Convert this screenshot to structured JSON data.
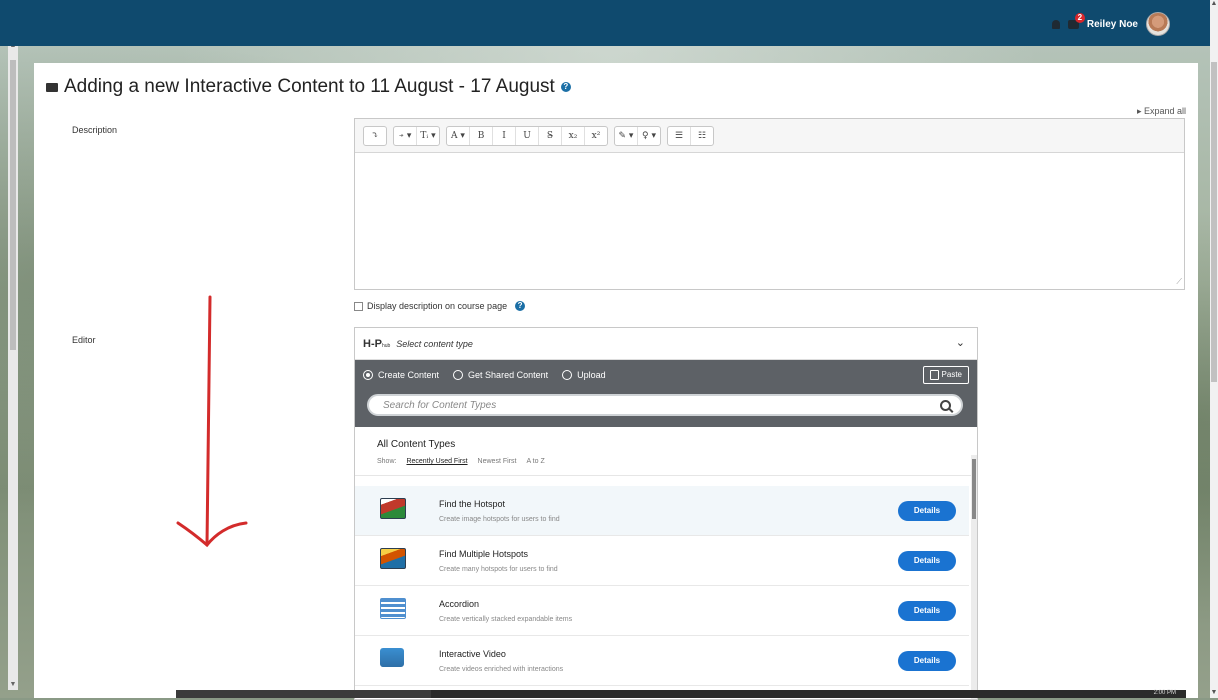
{
  "user": {
    "name": "Reiley Noe",
    "notification_count": "2"
  },
  "page": {
    "title": "Adding a new Interactive Content to 11 August - 17 August",
    "expand_all": "Expand all"
  },
  "form": {
    "description_label": "Description",
    "editor_label": "Editor",
    "display_description_label": "Display description on course page"
  },
  "toolbar": {
    "groups": [
      [
        "⤵"
      ],
      [
        "⍆ ▾",
        "Tᵢ ▾"
      ],
      [
        "A ▾",
        "B",
        "I",
        "U",
        "S̶",
        "x₂",
        "x²"
      ],
      [
        "✎ ▾",
        "♀ ▾"
      ],
      [
        "☰",
        "☷"
      ]
    ]
  },
  "h5p": {
    "logo": "H-P",
    "logo_suffix": "hub",
    "select_placeholder": "Select content type",
    "tabs": [
      "Create Content",
      "Get Shared Content",
      "Upload"
    ],
    "paste_label": "Paste",
    "search_placeholder": "Search for Content Types",
    "all_content_types": "All Content Types",
    "show_label": "Show:",
    "sort_options": [
      "Recently Used First",
      "Newest First",
      "A to Z"
    ],
    "items": [
      {
        "title": "Find the Hotspot",
        "desc": "Create image hotspots for users to find",
        "button": "Details",
        "icon": "hotspot-icon"
      },
      {
        "title": "Find Multiple Hotspots",
        "desc": "Create many hotspots for users to find",
        "button": "Details",
        "icon": "multi-hotspot-icon"
      },
      {
        "title": "Accordion",
        "desc": "Create vertically stacked expandable items",
        "button": "Details",
        "icon": "accordion-icon"
      },
      {
        "title": "Interactive Video",
        "desc": "Create videos enriched with interactions",
        "button": "Details",
        "icon": "video-icon"
      }
    ]
  },
  "taskbar": {
    "clock": "2:00 PM"
  },
  "colors": {
    "navbar": "#0f4a6e",
    "details_button": "#1a73d1",
    "h5p_bar": "#5d6166",
    "annotation": "#d32b2b"
  }
}
